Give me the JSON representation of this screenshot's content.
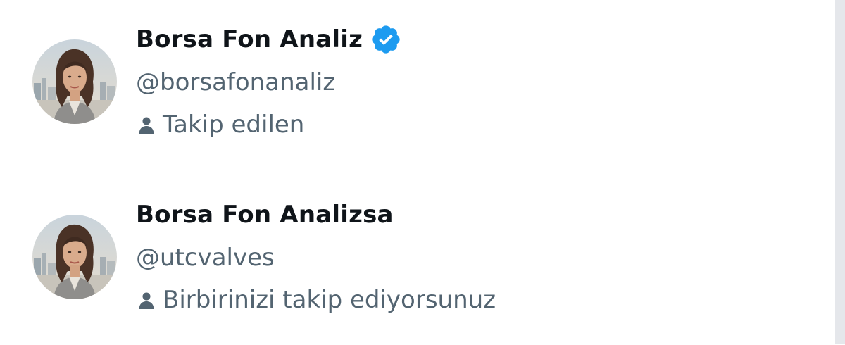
{
  "users": [
    {
      "display_name": "Borsa Fon Analiz",
      "handle": "@borsafonanaliz",
      "relation": "Takip edilen",
      "verified": true,
      "avatar_icon": "woman-portrait-avatar"
    },
    {
      "display_name": "Borsa Fon Analizsa",
      "handle": "@utcvalves",
      "relation": "Birbirinizi takip ediyorsunuz",
      "verified": false,
      "avatar_icon": "woman-portrait-avatar"
    }
  ],
  "colors": {
    "name": "#0f1419",
    "secondary": "#536471",
    "verified_badge": "#1d9bf0",
    "scrollbar": "#e5e7eb"
  },
  "icons": {
    "verified": "verified-badge-icon",
    "relation": "person-icon"
  }
}
